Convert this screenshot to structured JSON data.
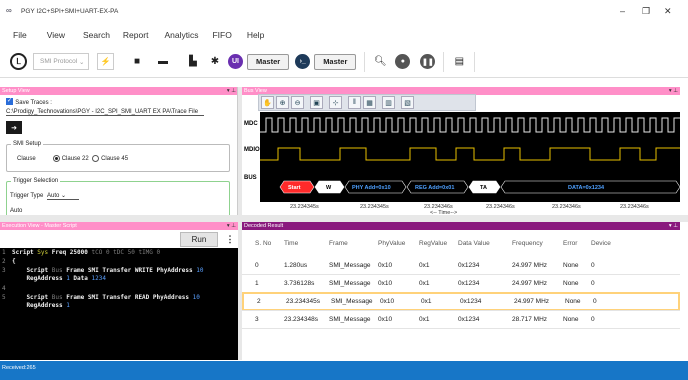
{
  "titlebar": {
    "title": "PGY I2C+SPI+SMI+UART-EX-PA",
    "minimize": "–",
    "maximize": "❐",
    "close": "✕"
  },
  "menu": [
    "File",
    "View",
    "Search",
    "Report",
    "Analytics",
    "FIFO",
    "Help"
  ],
  "toolbar": {
    "protocol_select": "SMI Protocol",
    "master1": "Master",
    "master2": "Master",
    "ui_badge": "UI"
  },
  "setup_view": {
    "header": "Setup View",
    "save_traces_label": "Save Traces :",
    "save_path": "C:\\Prodigy_Technovations\\PGY - I2C_SPI_SMI_UART EX PA\\Trace File",
    "smi_setup_legend": "SMI Setup",
    "clause_label": "Clause",
    "clause22": "Clause 22",
    "clause45": "Clause 45",
    "trigger_legend": "Trigger Selection",
    "trigger_type_label": "Trigger Type",
    "trigger_type_value": "Auto",
    "auto_label": "Auto"
  },
  "bus_view": {
    "header": "Bus View",
    "mdc": "MDC",
    "mdio": "MDIO",
    "bus": "BUS",
    "bus_segments": [
      "Start",
      "W",
      "PHY Add=0x10",
      "REG Add=0x01",
      "TA",
      "DATA=0x1234"
    ],
    "time_ticks": [
      "23.234345s",
      "23.234345s",
      "23.234346s",
      "23.234346s",
      "23.234346s",
      "23.234346s"
    ],
    "time_arrow": "<-- Time-->"
  },
  "exec_view": {
    "header": "Execution View - Master Script",
    "run_label": "Run",
    "more_label": "⋮",
    "lines": [
      {
        "n": "1",
        "parts": [
          [
            "Script ",
            "kw"
          ],
          [
            "Sys ",
            "ylw"
          ],
          [
            "Freq 25000 ",
            "kw"
          ],
          [
            "tCO 0 tDC 50 tIMG 0",
            "gry"
          ]
        ]
      },
      {
        "n": "2",
        "parts": [
          [
            "{",
            "kw"
          ]
        ]
      },
      {
        "n": "3",
        "parts": [
          [
            "    Script ",
            "kw"
          ],
          [
            "Bus ",
            "gry"
          ],
          [
            "Frame SMI Transfer WRITE PhyAddress ",
            "kw"
          ],
          [
            "10",
            "blu"
          ]
        ]
      },
      {
        "n": "",
        "parts": [
          [
            "    RegAddress ",
            "kw"
          ],
          [
            "1 ",
            "blu"
          ],
          [
            "Data ",
            "kw"
          ],
          [
            "1234",
            "blu"
          ]
        ]
      },
      {
        "n": "4",
        "parts": []
      },
      {
        "n": "5",
        "parts": [
          [
            "    Script ",
            "kw"
          ],
          [
            "Bus ",
            "gry"
          ],
          [
            "Frame SMI Transfer READ PhyAddress ",
            "kw"
          ],
          [
            "10",
            "blu"
          ]
        ]
      },
      {
        "n": "",
        "parts": [
          [
            "    RegAddress ",
            "kw"
          ],
          [
            "1",
            "blu"
          ]
        ]
      }
    ]
  },
  "results": {
    "header": "Decoded Result",
    "columns": [
      "S. No",
      "Time",
      "Frame",
      "PhyValue",
      "RegValue",
      "Data Value",
      "Frequency",
      "Error",
      "Device"
    ],
    "rows": [
      [
        "0",
        "1.280us",
        "SMI_Message",
        "0x10",
        "0x1",
        "0x1234",
        "24.997 MHz",
        "None",
        "0"
      ],
      [
        "1",
        "3.736128s",
        "SMI_Message",
        "0x10",
        "0x1",
        "0x1234",
        "24.997 MHz",
        "None",
        "0"
      ],
      [
        "2",
        "23.234345s",
        "SMI_Message",
        "0x10",
        "0x1",
        "0x1234",
        "24.997 MHz",
        "None",
        "0"
      ],
      [
        "3",
        "23.234348s",
        "SMI_Message",
        "0x10",
        "0x1",
        "0x1234",
        "28.717 MHz",
        "None",
        "0"
      ]
    ]
  },
  "status": {
    "received": "Received:265"
  }
}
